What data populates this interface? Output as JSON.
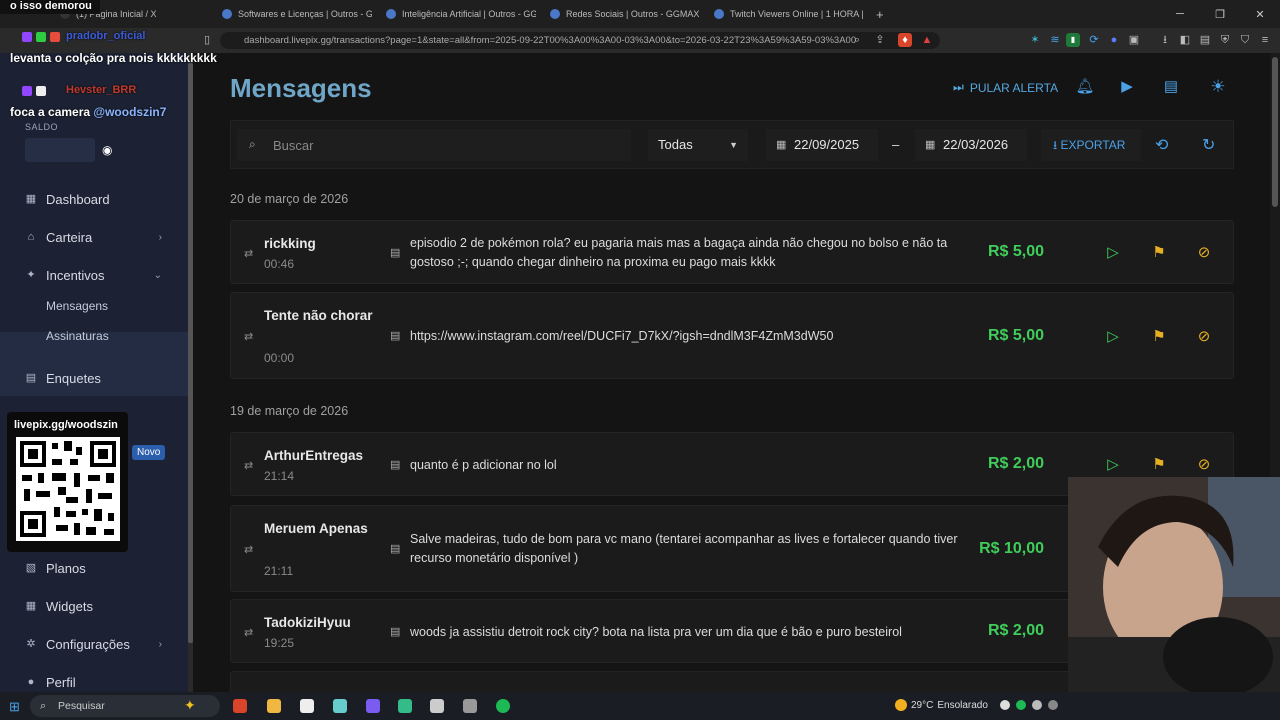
{
  "browser": {
    "tabs": [
      {
        "label": "(1) Página Inicial / X"
      },
      {
        "label": "Softwares e Licenças | Outros - GGMAX"
      },
      {
        "label": "Inteligência Artificial | Outros - GGMAX"
      },
      {
        "label": "Redes Sociais | Outros - GGMAX"
      },
      {
        "label": "Twitch Viewers Online | 1 HORA | 24"
      }
    ],
    "url": "dashboard.livepix.gg/transactions?page=1&state=all&from=2025-09-22T00%3A00%3A00-03%3A00&to=2026-03-22T23%3A59%3A59-03%3A00"
  },
  "sidebar": {
    "saldo_label": "SALDO",
    "items": [
      {
        "label": "Dashboard",
        "icon": "dashboard-icon"
      },
      {
        "label": "Carteira",
        "icon": "bank-icon"
      },
      {
        "label": "Incentivos",
        "icon": "sparkle-icon"
      },
      {
        "label": "Enquetes",
        "icon": "poll-icon"
      },
      {
        "label": "Planos",
        "icon": "plans-icon"
      },
      {
        "label": "Widgets",
        "icon": "widgets-icon"
      },
      {
        "label": "Configurações",
        "icon": "gear-icon"
      },
      {
        "label": "Perfil",
        "icon": "user-icon"
      }
    ],
    "sub_items": [
      {
        "label": "Mensagens"
      },
      {
        "label": "Assinaturas"
      }
    ],
    "novo_badge": "Novo"
  },
  "header": {
    "title": "Mensagens",
    "skip_alert": "PULAR ALERTA"
  },
  "filters": {
    "search_placeholder": "Buscar",
    "status_value": "Todas",
    "date_from": "22/09/2025",
    "date_to": "22/03/2026",
    "export_label": "EXPORTAR"
  },
  "groups": [
    {
      "date": "20 de março de 2026",
      "messages": [
        {
          "name": "rickking",
          "time": "00:46",
          "text": "episodio 2 de pokémon rola? eu pagaria mais mas a bagaça ainda não chegou no bolso e não ta gostoso ;-; quando chegar dinheiro na proxima eu pago mais kkkk",
          "amount": "R$ 5,00"
        },
        {
          "name": "Tente não chorar",
          "time": "00:00",
          "text": "https://www.instagram.com/reel/DUCFi7_D7kX/?igsh=dndlM3F4ZmM3dW50",
          "amount": "R$ 5,00"
        }
      ]
    },
    {
      "date": "19 de março de 2026",
      "messages": [
        {
          "name": "ArthurEntregas",
          "time": "21:14",
          "text": "quanto é p adicionar no lol",
          "amount": "R$ 2,00"
        },
        {
          "name": "Meruem Apenas",
          "time": "21:11",
          "text": "Salve madeiras, tudo de bom para vc mano (tentarei acompanhar as lives e fortalecer quando tiver recurso monetário disponível )",
          "amount": "R$ 10,00"
        },
        {
          "name": "TadokiziHyuu",
          "time": "19:25",
          "text": "woods ja assistiu detroit rock city? bota na lista pra ver um dia que é bão e puro besteirol",
          "amount": "R$ 2,00"
        }
      ]
    }
  ],
  "overlay": {
    "chat_top": "o isso demorou",
    "chat_user1": "pradobr_oficial",
    "chat_line1": "levanta o colção pra nois kkkkkkkkk",
    "chat_user2": "Hevster_BRR",
    "chat_line2_prefix": "foca a camera ",
    "chat_line2_mention": "@woodszin7",
    "qr_label": "livepix.gg/woodszin"
  },
  "taskbar": {
    "search_label": "Pesquisar",
    "temperature": "29°C",
    "weather": "Ensolarado"
  },
  "colors": {
    "accent": "#4aa1e8",
    "amount": "#3fce5a",
    "warning": "#e6b020",
    "sidebar": "#1c2233"
  }
}
